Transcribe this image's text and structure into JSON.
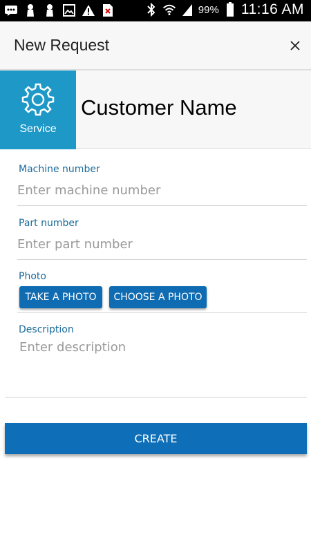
{
  "status_bar": {
    "battery_percent": "99%",
    "time": "11:16 AM",
    "icons": [
      "messaging-icon",
      "notification-icon",
      "notification-icon",
      "gallery-icon",
      "warning-icon",
      "no-sim-icon",
      "bluetooth-icon",
      "wifi-icon",
      "signal-icon",
      "battery-icon"
    ]
  },
  "header": {
    "title": "New Request"
  },
  "customer": {
    "service_label": "Service",
    "name": "Customer Name"
  },
  "form": {
    "machine_number": {
      "label": "Machine number",
      "placeholder": "Enter machine number",
      "value": ""
    },
    "part_number": {
      "label": "Part number",
      "placeholder": "Enter part number",
      "value": ""
    },
    "photo": {
      "label": "Photo",
      "take_label": "TAKE A PHOTO",
      "choose_label": "CHOOSE A PHOTO"
    },
    "description": {
      "label": "Description",
      "placeholder": "Enter description",
      "value": ""
    }
  },
  "create_label": "CREATE",
  "colors": {
    "accent": "#1e98c7",
    "primary_button": "#0f6cb3",
    "label": "#1a6a9a"
  }
}
